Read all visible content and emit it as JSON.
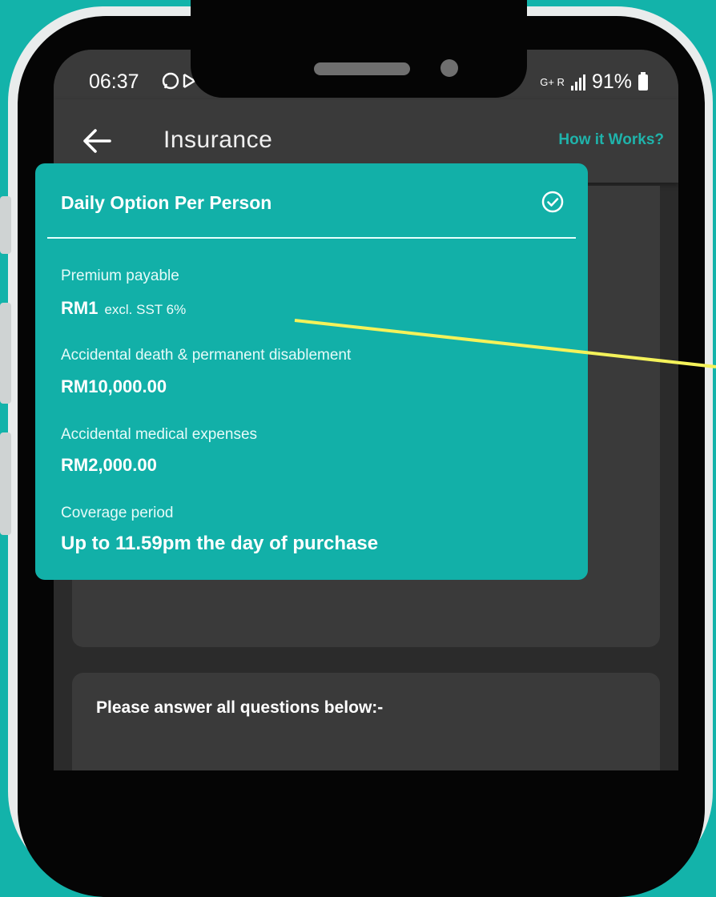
{
  "status_bar": {
    "time": "06:37",
    "battery": "91%",
    "network": "G+ R"
  },
  "app_bar": {
    "title": "Insurance",
    "how_it_works": "How it Works?"
  },
  "option_card": {
    "title": "Daily Option Per Person",
    "fields": [
      {
        "label": "Premium payable",
        "value": "RM1",
        "note": "excl. SST 6%"
      },
      {
        "label": "Accidental death & permanent disablement",
        "value": "RM10,000.00"
      },
      {
        "label": "Accidental medical expenses",
        "value": "RM2,000.00"
      },
      {
        "label": "Coverage period",
        "value": "Up to 11.59pm the day of purchase"
      }
    ]
  },
  "questions": {
    "title": "Please answer all questions below:-"
  },
  "colors": {
    "accent": "#12b0a8",
    "background": "#13b3aa",
    "surface": "#3a3a3a",
    "pointer": "#f4f25a"
  }
}
